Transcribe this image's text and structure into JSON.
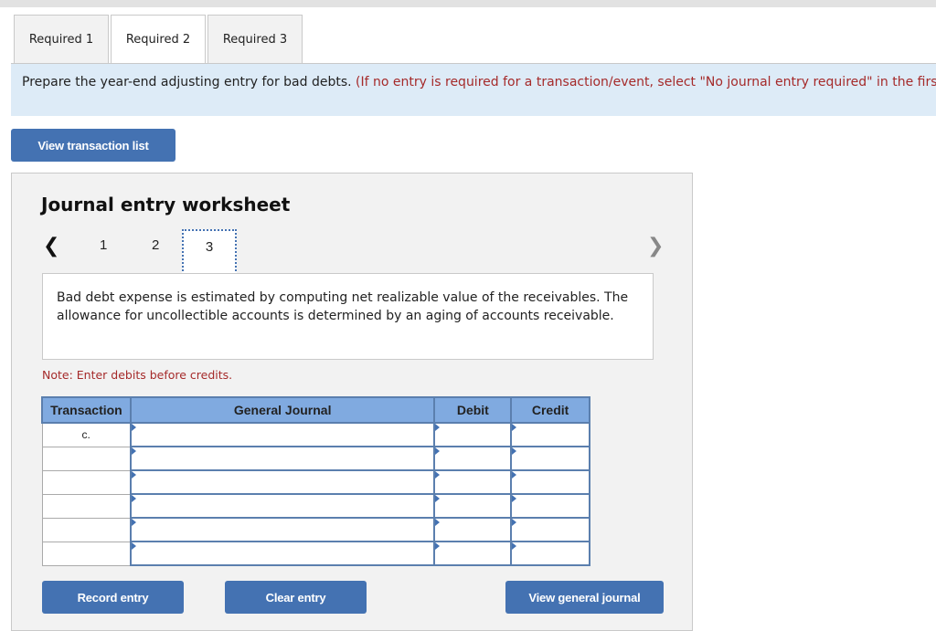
{
  "tabs": [
    {
      "label": "Required 1",
      "active": false
    },
    {
      "label": "Required 2",
      "active": true
    },
    {
      "label": "Required 3",
      "active": false
    }
  ],
  "instructions": {
    "main": "Prepare the year-end adjusting entry for bad debts.",
    "note": "(If no entry is required for a transaction/event, select \"No journal entry required\" in the first account field.)"
  },
  "view_transaction_list_label": "View transaction list",
  "worksheet": {
    "title": "Journal entry worksheet",
    "nav": {
      "prev_icon": "chevron-left-icon",
      "next_icon": "chevron-right-icon",
      "pages": [
        "1",
        "2",
        "3"
      ],
      "current_page": "3"
    },
    "description": "Bad debt expense is estimated by computing net realizable value of the receivables. The allowance for uncollectible accounts is determined by an aging of accounts receivable.",
    "note": "Note: Enter debits before credits.",
    "table": {
      "headers": [
        "Transaction",
        "General Journal",
        "Debit",
        "Credit"
      ],
      "rows": [
        {
          "transaction": "c.",
          "account": "",
          "debit": "",
          "credit": ""
        },
        {
          "transaction": "",
          "account": "",
          "debit": "",
          "credit": ""
        },
        {
          "transaction": "",
          "account": "",
          "debit": "",
          "credit": ""
        },
        {
          "transaction": "",
          "account": "",
          "debit": "",
          "credit": ""
        },
        {
          "transaction": "",
          "account": "",
          "debit": "",
          "credit": ""
        },
        {
          "transaction": "",
          "account": "",
          "debit": "",
          "credit": ""
        }
      ]
    },
    "buttons": {
      "record": "Record entry",
      "clear": "Clear entry",
      "view_journal": "View general journal"
    }
  }
}
